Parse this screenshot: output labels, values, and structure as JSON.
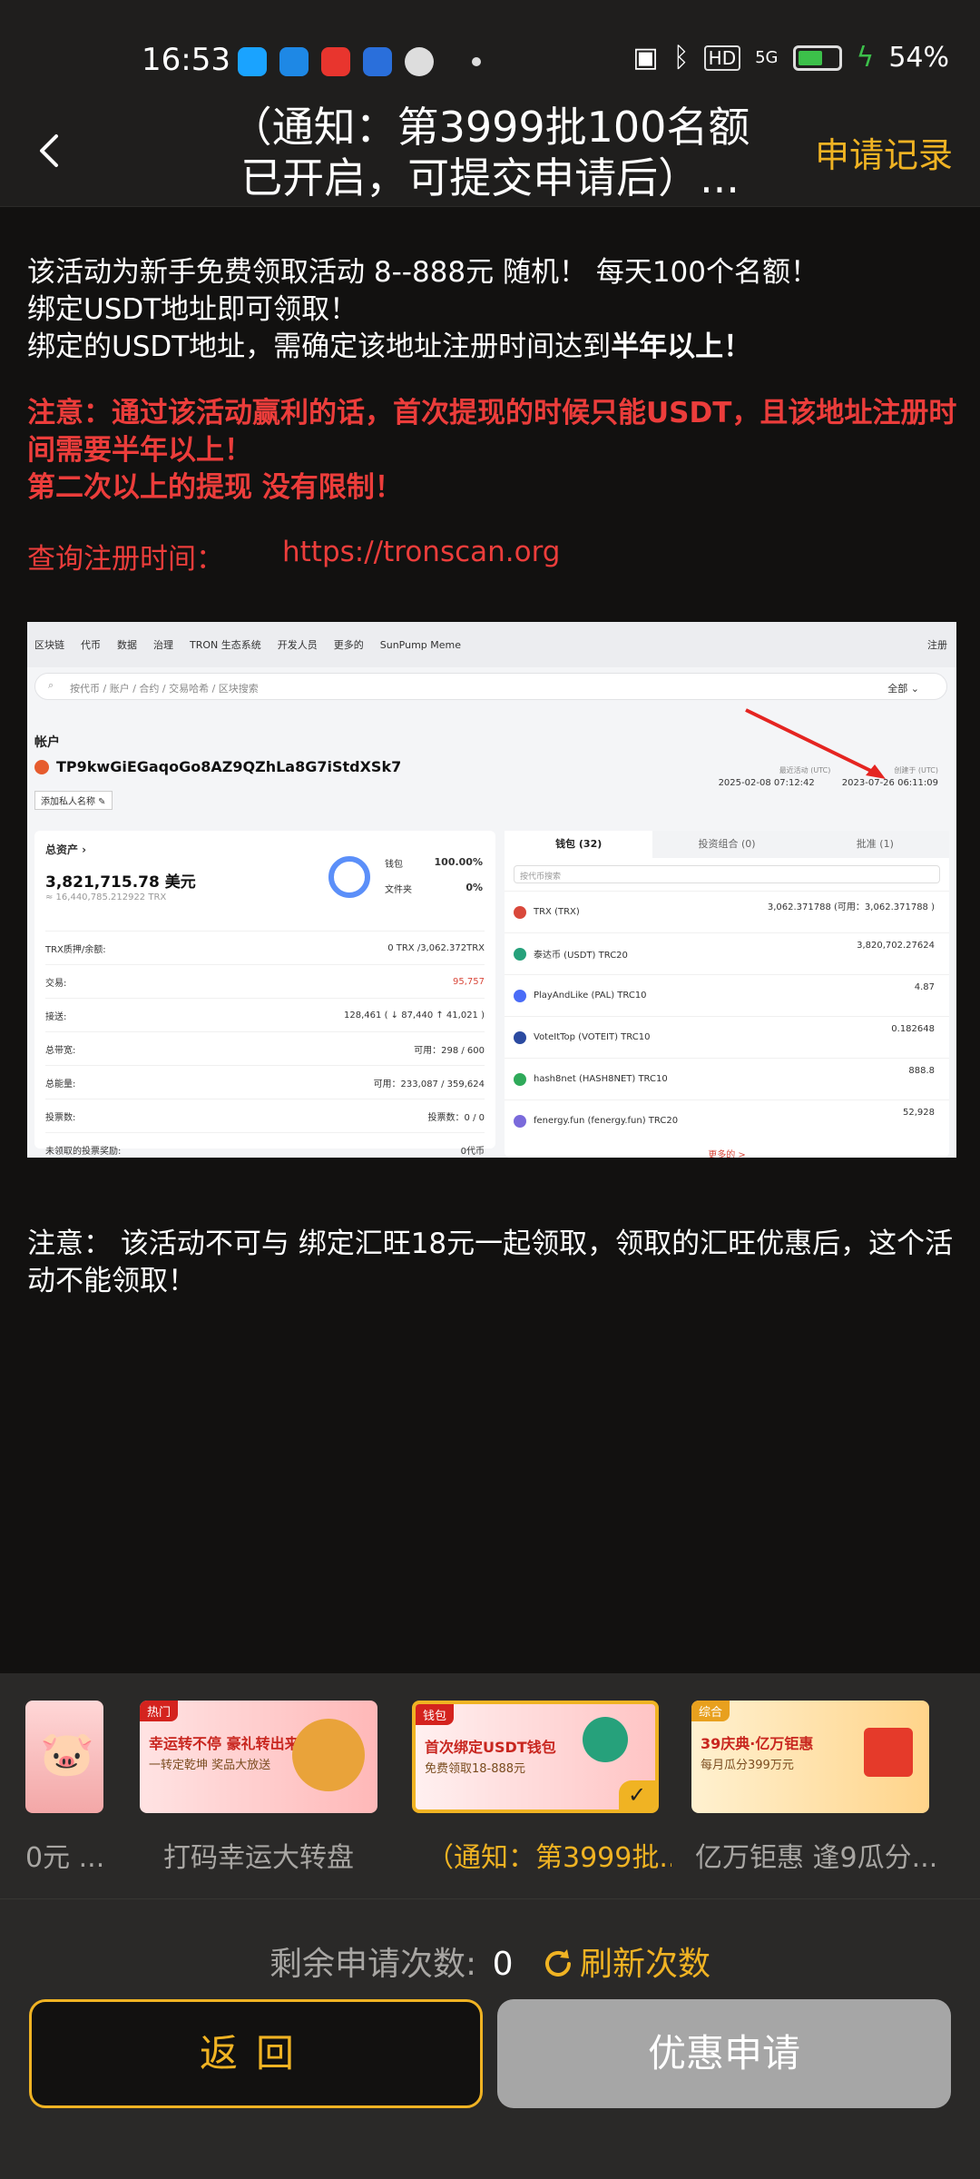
{
  "status_bar": {
    "time": "16:53",
    "battery": "54%",
    "network": "5G",
    "hd": "HD"
  },
  "header": {
    "title_line1": "（通知：第3999批100名额",
    "title_line2": "已开启，可提交申请后）...",
    "apply_record": "申请记录"
  },
  "content": {
    "p1_l1": "该活动为新手免费领取活动   8--888元 随机！   每天100个名额！",
    "p1_l2": "绑定USDT地址即可领取！",
    "p1_l3a": "绑定的USDT地址，需确定该地址注册时间达到",
    "p1_l3b": "半年以上！",
    "p2_l1": "注意：通过该活动赢利的话，首次提现的时候只能USDT，且该地址注册时",
    "p2_l2": "间需要半年以上！",
    "p2_l3": "第二次以上的提现  没有限制！",
    "query_label": "查询注册时间：",
    "query_link": "https://tronscan.org",
    "note2_l1": " 注意： 该活动不可与 绑定汇旺18元一起领取，领取的汇旺优惠后，这个活",
    "note2_l2": "动不能领取！"
  },
  "screenshot": {
    "nav": [
      "区块链",
      "代币",
      "数据",
      "治理",
      "TRON 生态系统",
      "开发人员",
      "更多的",
      "SunPump Meme"
    ],
    "nav_right": "注册",
    "search_placeholder": "按代币 / 账户 / 合约 / 交易哈希 / 区块搜索",
    "search_all": "全部 ⌄",
    "account_label": "帐户",
    "address": "TP9kwGiEGaqoGo8AZ9QZhLa8G7iStdXSk7",
    "tag": "添加私人名称 ✎",
    "date_label1": "最近活动 (UTC)",
    "date_label2": "创建于 (UTC)",
    "last_active": "2025-02-08 07:12:42",
    "created": "2023-07-26 06:11:09",
    "total_assets_label": "总资产 ›",
    "total_usd": "3,821,715.78 美元",
    "total_trx": "≈ 16,440,785.212922 TRX",
    "wallet_label": "钱包",
    "wallet_pct": "100.00%",
    "file_label": "文件夹",
    "file_pct": "0%",
    "rows": [
      {
        "k": "TRX质押/余额:",
        "v": "0 TRX /3,062.372TRX"
      },
      {
        "k": "交易:",
        "v": "95,757"
      },
      {
        "k": "接送:",
        "v": "128,461  ( ↓ 87,440  ↑ 41,021 )"
      },
      {
        "k": "总带宽:",
        "v": "可用：298 / 600"
      },
      {
        "k": "总能量:",
        "v": "可用：233,087 / 359,624"
      },
      {
        "k": "投票数:",
        "v": "投票数：0 / 0"
      },
      {
        "k": "未领取的投票奖励:",
        "v": "0代币"
      }
    ],
    "tabs": [
      "钱包 (32)",
      "投资组合 (0)",
      "批准 (1)"
    ],
    "token_search": "按代币搜索",
    "tokens": [
      {
        "name": "TRX (TRX)",
        "amt": "3,062.371788 (可用：3,062.371788 )",
        "color": "#d9483b"
      },
      {
        "name": "泰达币 (USDT)  TRC20",
        "amt": "3,820,702.27624",
        "color": "#26a17b"
      },
      {
        "name": "PlayAndLike (PAL)  TRC10",
        "amt": "4.87",
        "color": "#4a6cf7"
      },
      {
        "name": "VoteItTop (VOTEIT)  TRC10",
        "amt": "0.182648",
        "color": "#2b4aa0"
      },
      {
        "name": "hash8net (HASH8NET)  TRC10",
        "amt": "888.8",
        "color": "#2faa5a"
      },
      {
        "name": "fenergy.fun (fenergy.fun)  TRC20",
        "amt": "52,928",
        "color": "#7a6adb"
      }
    ],
    "more": "更多的 >"
  },
  "carousel": {
    "items": [
      {
        "label": "0元 ..."
      },
      {
        "label": "打码幸运大转盘",
        "ribbon": "热门",
        "t1": "幸运转不停 豪礼转出来",
        "t2": "一转定乾坤 奖品大放送"
      },
      {
        "label": "（通知：第3999批...",
        "ribbon": "钱包",
        "t1": "首次绑定USDT钱包",
        "t2": "免费领取18-888元"
      },
      {
        "label": "亿万钜惠 逢9瓜分...",
        "ribbon": "综合",
        "t1": "39庆典·亿万钜惠",
        "t2": "每月瓜分399万元"
      }
    ]
  },
  "bottom": {
    "remaining_label": "剩余申请次数:",
    "remaining_count": "0",
    "refresh_label": "刷新次数",
    "back_label": "返回",
    "apply_label": "优惠申请"
  }
}
